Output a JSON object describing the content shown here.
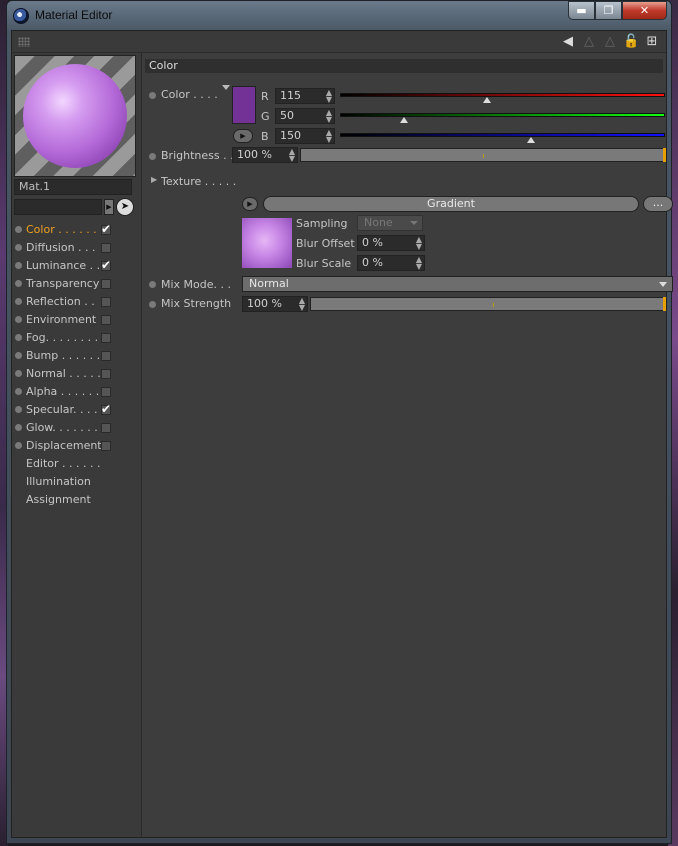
{
  "window": {
    "title": "Material Editor"
  },
  "material": {
    "name": "Mat.1"
  },
  "channels": [
    {
      "label": "Color . . . . . .",
      "checked": true,
      "active": true
    },
    {
      "label": "Diffusion . . .",
      "checked": false
    },
    {
      "label": "Luminance . .",
      "checked": true
    },
    {
      "label": "Transparency",
      "checked": false
    },
    {
      "label": "Reflection  . .",
      "checked": false
    },
    {
      "label": "Environment",
      "checked": false
    },
    {
      "label": "Fog. . . . . . . .",
      "checked": false
    },
    {
      "label": "Bump . . . . . .",
      "checked": false
    },
    {
      "label": "Normal . . . . .",
      "checked": false
    },
    {
      "label": "Alpha . . . . . .",
      "checked": false
    },
    {
      "label": "Specular. . . .",
      "checked": true
    },
    {
      "label": "Glow. . . . . . .",
      "checked": false
    },
    {
      "label": "Displacement",
      "checked": false
    },
    {
      "label": "Editor . . . . . ."
    },
    {
      "label": "Illumination"
    },
    {
      "label": "Assignment"
    }
  ],
  "section": {
    "title": "Color"
  },
  "color": {
    "label": "Color . . . .",
    "swatch": "#733296",
    "r_label": "R",
    "r": "115",
    "r_frac": 0.451,
    "g_label": "G",
    "g": "50",
    "g_frac": 0.196,
    "b_label": "B",
    "b": "150",
    "b_frac": 0.588
  },
  "brightness": {
    "label": "Brightness . .",
    "value": "100 %"
  },
  "texture": {
    "label": "Texture . . . . .",
    "shader": "Gradient",
    "more": "...",
    "sampling_label": "Sampling",
    "sampling_value": "None",
    "blur_offset_label": "Blur Offset",
    "blur_offset": "0 %",
    "blur_scale_label": "Blur Scale",
    "blur_scale": "0 %"
  },
  "mix_mode": {
    "label": "Mix Mode. . .",
    "value": "Normal"
  },
  "mix_strength": {
    "label": "Mix Strength",
    "value": "100 %"
  }
}
